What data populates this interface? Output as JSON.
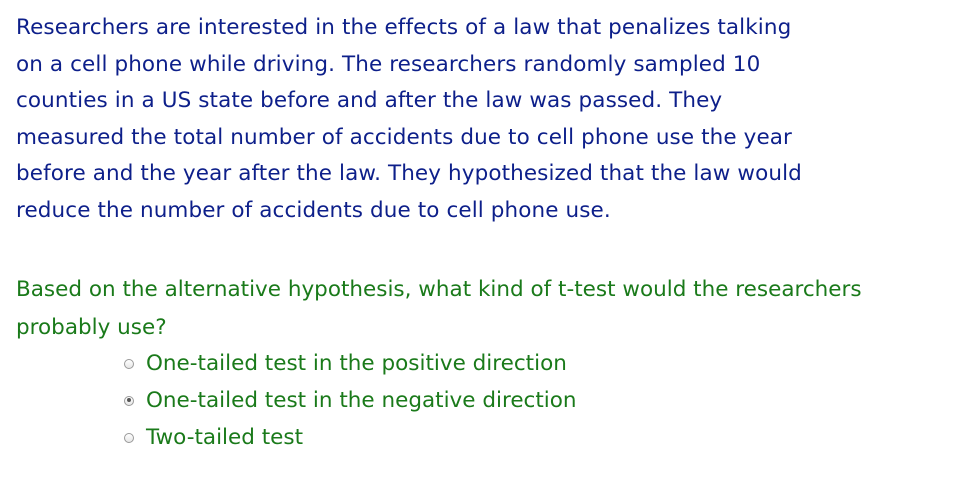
{
  "passage": {
    "lines": [
      "Researchers are interested in the effects of a law that penalizes talking",
      "on a cell phone while driving. The researchers randomly sampled 10",
      "counties in a US state before and after the law was passed. They",
      "measured the total number of accidents due to cell phone use the year",
      "before and the year after the law. They hypothesized that the law would",
      "reduce the number of accidents due to cell phone use."
    ]
  },
  "question": {
    "lines": [
      "Based on the alternative hypothesis, what kind of t-test would the researchers",
      "probably use?"
    ],
    "options": [
      {
        "label": "One-tailed test in the positive direction",
        "selected": false
      },
      {
        "label": "One-tailed test in the negative direction",
        "selected": true
      },
      {
        "label": "Two-tailed test",
        "selected": false
      }
    ]
  },
  "colors": {
    "passage_text": "#0d1f8a",
    "question_text": "#1a7a1a"
  }
}
